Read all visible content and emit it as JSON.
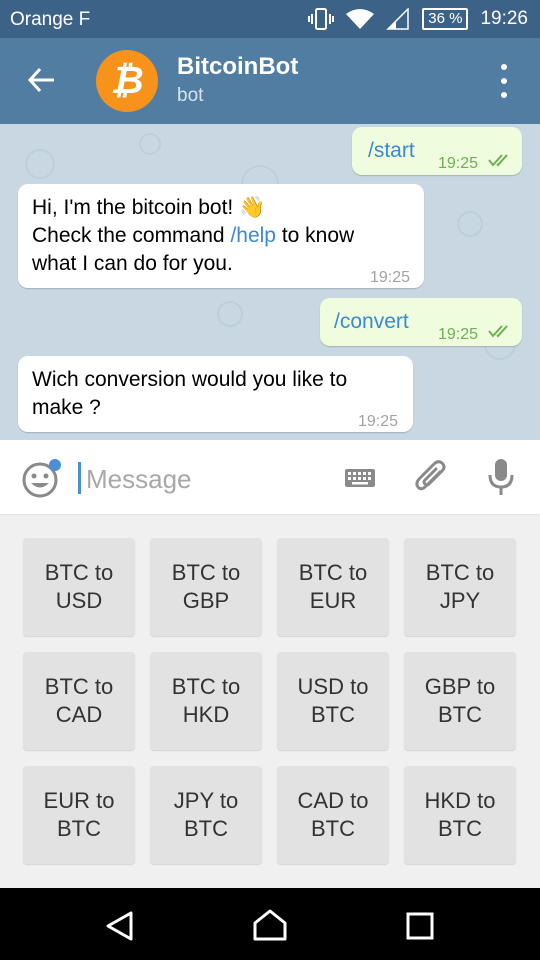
{
  "status_bar": {
    "carrier": "Orange F",
    "battery": "36 %",
    "time": "19:26"
  },
  "header": {
    "title": "BitcoinBot",
    "subtitle": "bot",
    "avatar_symbol": "₿",
    "avatar_color": "#f7931a"
  },
  "messages": [
    {
      "direction": "out",
      "text": "/start",
      "time": "19:25"
    },
    {
      "direction": "in",
      "line1": "Hi, I'm the bitcoin bot! 👋",
      "line2_before": "Check the command ",
      "line2_command": "/help",
      "line2_after": " to know",
      "line3": "what I can do for you.",
      "time": "19:25"
    },
    {
      "direction": "out",
      "text": "/convert",
      "time": "19:25"
    },
    {
      "direction": "in",
      "text": "Wich conversion would you like to make ?",
      "time": "19:25"
    }
  ],
  "input": {
    "placeholder": "Message"
  },
  "keyboard": [
    [
      "BTC to\nUSD",
      "BTC to\nGBP",
      "BTC to\nEUR",
      "BTC to\nJPY"
    ],
    [
      "BTC to\nCAD",
      "BTC to\nHKD",
      "USD to\nBTC",
      "GBP to\nBTC"
    ],
    [
      "EUR to\nBTC",
      "JPY to\nBTC",
      "CAD to\nBTC",
      "HKD to\nBTC"
    ]
  ],
  "colors": {
    "header": "#517da2",
    "status_bar": "#3d6287",
    "chat_bg": "#c8d7e2",
    "outgoing": "#effdde",
    "link": "#3a8ad0",
    "check": "#6fae54"
  }
}
